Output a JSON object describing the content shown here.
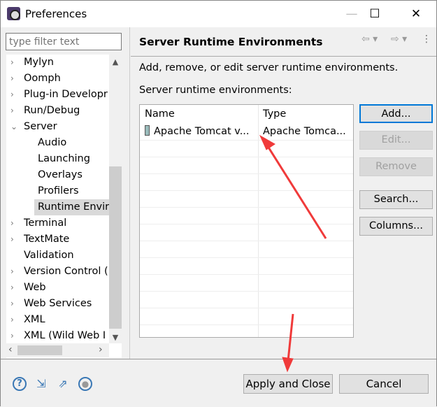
{
  "window": {
    "title": "Preferences",
    "minimize": "—",
    "maximize": "☐",
    "close": "✕"
  },
  "filter": {
    "placeholder": "type filter text"
  },
  "tree": [
    {
      "label": "Mylyn",
      "twisty": "›"
    },
    {
      "label": "Oomph",
      "twisty": "›"
    },
    {
      "label": "Plug-in Developr",
      "twisty": "›"
    },
    {
      "label": "Run/Debug",
      "twisty": "›"
    },
    {
      "label": "Server",
      "twisty": "⌄"
    },
    {
      "label": "Audio",
      "twisty": ""
    },
    {
      "label": "Launching",
      "twisty": ""
    },
    {
      "label": "Overlays",
      "twisty": ""
    },
    {
      "label": "Profilers",
      "twisty": ""
    },
    {
      "label": "Runtime Envir",
      "twisty": "",
      "selected": true
    },
    {
      "label": "Terminal",
      "twisty": "›"
    },
    {
      "label": "TextMate",
      "twisty": "›"
    },
    {
      "label": "Validation",
      "twisty": ""
    },
    {
      "label": "Version Control (",
      "twisty": "›"
    },
    {
      "label": "Web",
      "twisty": "›"
    },
    {
      "label": "Web Services",
      "twisty": "›"
    },
    {
      "label": "XML",
      "twisty": "›"
    },
    {
      "label": "XML (Wild Web I",
      "twisty": "›"
    }
  ],
  "page": {
    "title": "Server Runtime Environments",
    "description": "Add, remove, or edit server runtime environments.",
    "list_label": "Server runtime environments:",
    "columns": [
      "Name",
      "Type"
    ],
    "rows": [
      {
        "name": "Apache Tomcat v...",
        "type": "Apache Tomca..."
      }
    ],
    "buttons": {
      "add": "Add...",
      "edit": "Edit...",
      "remove": "Remove",
      "search": "Search...",
      "columns": "Columns..."
    }
  },
  "footer": {
    "apply_close": "Apply and Close",
    "cancel": "Cancel"
  },
  "annotation_color": "#f03a3a"
}
